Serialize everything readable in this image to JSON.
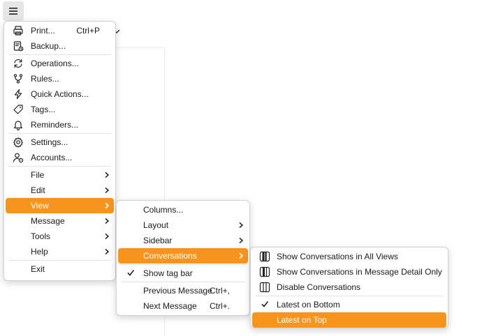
{
  "colors": {
    "accent": "#f7941d",
    "hover_text": "#ffffff"
  },
  "main_menu": {
    "groups": [
      [
        {
          "label": "Print...",
          "shortcut": "Ctrl+P",
          "icon": "printer-icon"
        },
        {
          "label": "Backup...",
          "icon": "backup-icon"
        }
      ],
      [
        {
          "label": "Operations...",
          "icon": "sync-icon"
        },
        {
          "label": "Rules...",
          "icon": "rules-icon"
        },
        {
          "label": "Quick Actions...",
          "icon": "lightning-icon"
        },
        {
          "label": "Tags...",
          "icon": "tag-icon"
        },
        {
          "label": "Reminders...",
          "icon": "bell-icon"
        }
      ],
      [
        {
          "label": "Settings...",
          "icon": "gear-icon"
        },
        {
          "label": "Accounts...",
          "icon": "account-icon"
        }
      ],
      [
        {
          "label": "File",
          "submenu": true
        },
        {
          "label": "Edit",
          "submenu": true
        },
        {
          "label": "View",
          "submenu": true,
          "highlighted": true
        },
        {
          "label": "Message",
          "submenu": true
        },
        {
          "label": "Tools",
          "submenu": true
        },
        {
          "label": "Help",
          "submenu": true
        }
      ],
      [
        {
          "label": "Exit"
        }
      ]
    ]
  },
  "view_menu": {
    "groups": [
      [
        {
          "label": "Columns..."
        },
        {
          "label": "Layout",
          "submenu": true
        },
        {
          "label": "Sidebar",
          "submenu": true
        },
        {
          "label": "Conversations",
          "submenu": true,
          "highlighted": true
        }
      ],
      [
        {
          "label": "Show tag bar",
          "checked": true
        }
      ],
      [
        {
          "label": "Previous Message",
          "shortcut": "Ctrl+,"
        },
        {
          "label": "Next Message",
          "shortcut": "Ctrl+."
        }
      ]
    ]
  },
  "conversations_menu": {
    "groups": [
      [
        {
          "label": "Show Conversations in All Views",
          "icon": "conversations-all-icon"
        },
        {
          "label": "Show Conversations in Message Detail Only",
          "icon": "conversations-detail-icon"
        },
        {
          "label": "Disable Conversations",
          "icon": "conversations-disabled-icon"
        }
      ],
      [
        {
          "label": "Latest on Bottom",
          "checked": true
        },
        {
          "label": "Latest on Top",
          "highlighted": true
        }
      ]
    ]
  }
}
